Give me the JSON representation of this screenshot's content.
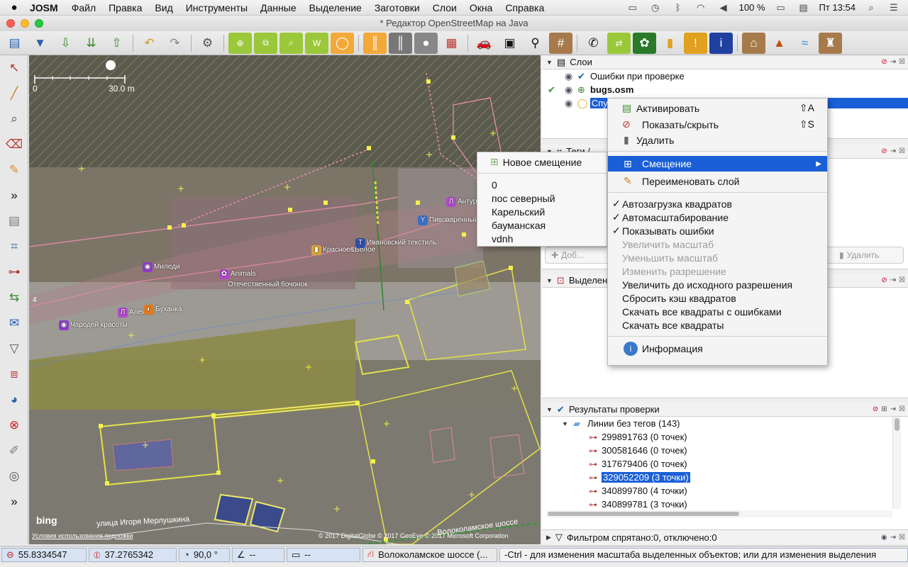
{
  "menubar": {
    "apple": "",
    "app": "JOSM",
    "items": [
      "Файл",
      "Правка",
      "Вид",
      "Инструменты",
      "Данные",
      "Выделение",
      "Заготовки",
      "Слои",
      "Окна",
      "Справка"
    ],
    "battery": "100 %",
    "clock": "Пт 13:54"
  },
  "window": {
    "title": "* Редактор OpenStreetMap на Java"
  },
  "toolbar": {
    "buttons": [
      "open",
      "save",
      "download",
      "download-area",
      "upload",
      "undo",
      "redo",
      "preferences",
      "select-all",
      "copy",
      "zoom",
      "wms",
      "tag-selector",
      "highway",
      "railway",
      "power",
      "building",
      "car",
      "bus",
      "bicycle",
      "rail",
      "phone",
      "traffic",
      "sports",
      "shopping",
      "warning",
      "info",
      "industry",
      "mountain",
      "water",
      "castle"
    ]
  },
  "map": {
    "scale_start": "0",
    "scale_end": "30.0 m",
    "left_number": "4",
    "attribution": "© 2017 DigitalGlobe © 2017 GeoEye © 2017 Microsoft Corporation",
    "bing": "bing",
    "bing_terms": "Условия использования подложки",
    "street1": "улица Игоря Мерлушкина",
    "street2": "Волоколамское шоссе",
    "pois": [
      {
        "name": "Миледи",
        "color": "#8d3bc8"
      },
      {
        "name": "Аленка",
        "color": "#b048c8"
      },
      {
        "name": "Буханка",
        "color": "#e07a1a"
      },
      {
        "name": "Чародей красоты",
        "color": "#8d3bc8"
      },
      {
        "name": "Animals",
        "color": "#b048c8"
      },
      {
        "name": "Отечественный бочонок",
        "color": "#d9a23a"
      },
      {
        "name": "Красное&Белое",
        "color": "#d9a23a"
      },
      {
        "name": "Ивановский текстиль",
        "color": "#2f4fa6"
      },
      {
        "name": "Пивоваренный",
        "color": "#3a6ec8"
      },
      {
        "name": "Антураж",
        "color": "#b048c8"
      }
    ]
  },
  "layers_panel": {
    "title": "Слои",
    "layers": [
      {
        "name": "Ошибки при проверке",
        "status": ""
      },
      {
        "name": "bugs.osm",
        "status": "active"
      },
      {
        "name": "Спутник",
        "status": "selected"
      }
    ]
  },
  "tags_panel": {
    "title": "Теги / ...",
    "add_label": "Доб...",
    "delete_label": "Удалить"
  },
  "selection_panel": {
    "title": "Выделени..."
  },
  "validation_panel": {
    "title": "Результаты проверки",
    "group": "Линии без тегов (143)",
    "items": [
      {
        "label": "299891763 (0 точек)",
        "selected": false
      },
      {
        "label": "300581646 (0 точек)",
        "selected": false
      },
      {
        "label": "317679406 (0 точек)",
        "selected": false
      },
      {
        "label": "329052209 (3 точки)",
        "selected": true
      },
      {
        "label": "340899780 (4 точки)",
        "selected": false
      },
      {
        "label": "340899781 (3 точки)",
        "selected": false
      }
    ]
  },
  "filter_panel": {
    "title": "Фильтром спрятано:0, отключено:0"
  },
  "context_menu": {
    "items": [
      {
        "label": "Активировать",
        "key": "⇧A",
        "state": "enabled"
      },
      {
        "label": "Показать/скрыть",
        "key": "⇧S",
        "state": "enabled"
      },
      {
        "label": "Удалить",
        "key": "",
        "state": "enabled"
      },
      {
        "label": "Смещение",
        "key": "▶",
        "state": "selected"
      },
      {
        "label": "Переименовать слой",
        "key": "",
        "state": "enabled"
      },
      {
        "label": "Автозагрузка квадратов",
        "key": "",
        "state": "checked"
      },
      {
        "label": "Автомасштабирование",
        "key": "",
        "state": "checked"
      },
      {
        "label": "Показывать ошибки",
        "key": "",
        "state": "checked"
      },
      {
        "label": "Увеличить масштаб",
        "key": "",
        "state": "disabled"
      },
      {
        "label": "Уменьшить масштаб",
        "key": "",
        "state": "disabled"
      },
      {
        "label": "Изменить разрешение",
        "key": "",
        "state": "disabled"
      },
      {
        "label": "Увеличить до исходного разрешения",
        "key": "",
        "state": "enabled"
      },
      {
        "label": "Сбросить кэш квадратов",
        "key": "",
        "state": "enabled"
      },
      {
        "label": "Скачать все квадраты с ошибками",
        "key": "",
        "state": "enabled"
      },
      {
        "label": "Скачать все квадраты",
        "key": "",
        "state": "enabled"
      },
      {
        "label": "Информация",
        "key": "",
        "state": "enabled"
      }
    ]
  },
  "offset_submenu": {
    "new_label": "Новое смещение",
    "offsets": [
      "0",
      "пос северный",
      "Карельский",
      "бауманская",
      "vdnh"
    ]
  },
  "statusbar": {
    "lat": "55.8334547",
    "lon": "37.2765342",
    "heading": "90,0 °",
    "angle": "--",
    "distance": "--",
    "street": "Волоколамское шоссе (...",
    "hint": "-Ctrl - для изменения масштаба выделенных объектов; или для изменения выделения"
  }
}
